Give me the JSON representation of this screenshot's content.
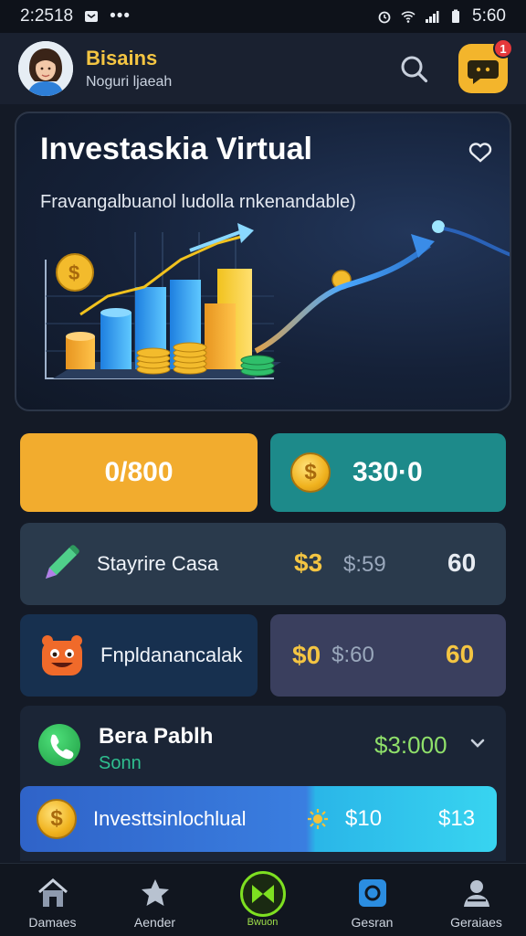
{
  "statusbar": {
    "time": "2:2518",
    "battery_time": "5:60"
  },
  "header": {
    "user_name": "Bisains",
    "user_sub": "Noguri ljaeah",
    "notification_count": "1"
  },
  "hero": {
    "title": "Investaskia Virtual",
    "subtitle": "Fravangalbuanol ludolla rnkenandable)"
  },
  "tiles": {
    "primary_value": "0/800",
    "secondary_value": "330·0"
  },
  "rows": {
    "row1": {
      "label": "Stayrire Casa",
      "amount_yellow": "$3",
      "amount_gray": "$:59",
      "amount_white": "60"
    },
    "row2": {
      "label": "Fnpldanancalak",
      "amount_yellow": "$0",
      "amount_gray": "$:60",
      "amount_white": "60"
    }
  },
  "account": {
    "title": "Bera Pablh",
    "sub": "Sonn",
    "amount": "$3:000"
  },
  "invest_bar": {
    "label": "Investtsinlochlual",
    "value1": "$10",
    "value2": "$13"
  },
  "nav": {
    "items": [
      {
        "label": "Damaes",
        "icon": "home-icon"
      },
      {
        "label": "Aender",
        "icon": "star-icon"
      },
      {
        "label": "Bwuon",
        "icon": "play-icon"
      },
      {
        "label": "Gesran",
        "icon": "square-icon"
      },
      {
        "label": "Geraiaes",
        "icon": "profile-icon"
      }
    ]
  },
  "colors": {
    "accent_yellow": "#f2ac2e",
    "accent_teal": "#1d8a8a",
    "nav_active": "#7ee021",
    "background": "#141a26"
  }
}
